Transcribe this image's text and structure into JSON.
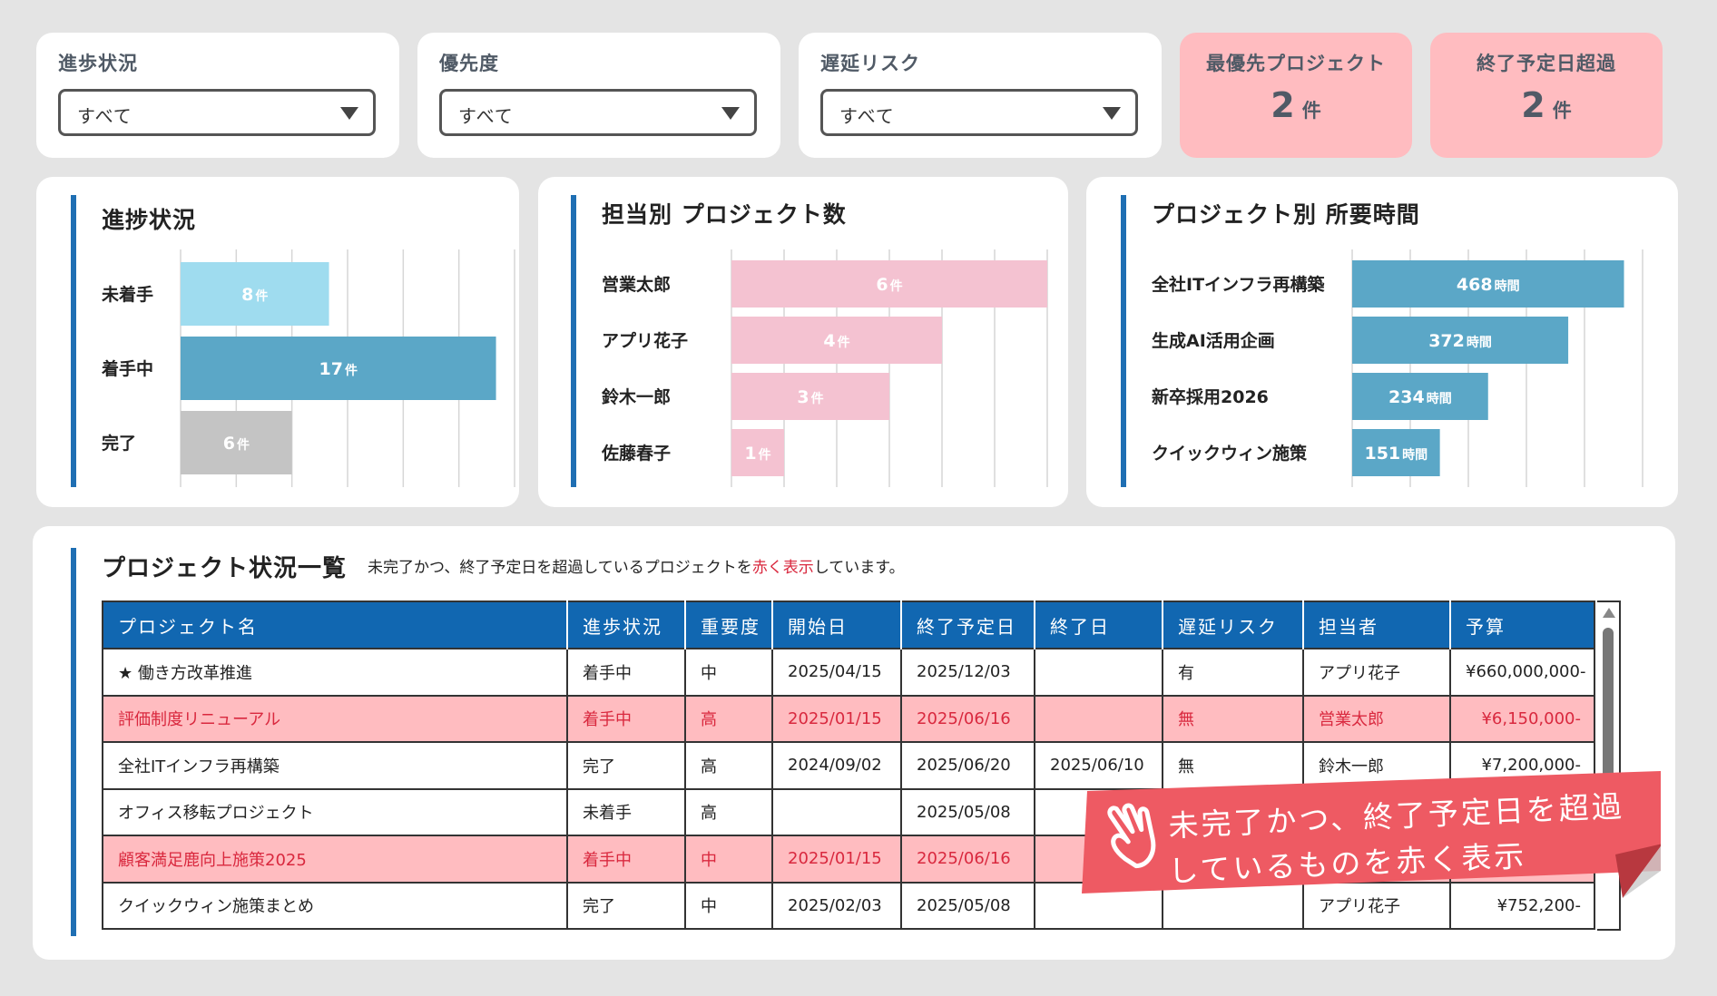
{
  "filters": [
    {
      "label": "進歩状況",
      "value": "すべて"
    },
    {
      "label": "優先度",
      "value": "すべて"
    },
    {
      "label": "遅延リスク",
      "value": "すべて"
    }
  ],
  "kpis": [
    {
      "label": "最優先プロジェクト",
      "value": "2",
      "unit": "件"
    },
    {
      "label": "終了予定日超過",
      "value": "2",
      "unit": "件"
    }
  ],
  "colors": {
    "accent": "#1f6fb3",
    "header_blue": "#1167b1",
    "overdue_bg": "#ffbcc0",
    "overdue_text": "#d9283e",
    "callout": "#ee5a63"
  },
  "charts": {
    "status": {
      "title": "進捗状況",
      "chart_data": {
        "type": "bar",
        "orientation": "horizontal",
        "categories": [
          "未着手",
          "着手中",
          "完了"
        ],
        "values": [
          8,
          17,
          6
        ],
        "unit": "件",
        "colors": [
          "#9fdcef",
          "#5ba7c7",
          "#c4c4c4"
        ],
        "xlim": [
          0,
          18
        ],
        "grid": true
      }
    },
    "owner": {
      "title": "担当別 プロジェクト数",
      "chart_data": {
        "type": "bar",
        "orientation": "horizontal",
        "categories": [
          "営業太郎",
          "アプリ花子",
          "鈴木一郎",
          "佐藤春子"
        ],
        "values": [
          6,
          4,
          3,
          1
        ],
        "unit": "件",
        "colors": [
          "#f4c2d1",
          "#f4c2d1",
          "#f4c2d1",
          "#f4c2d1"
        ],
        "xlim": [
          0,
          6
        ],
        "grid": true
      }
    },
    "hours": {
      "title": "プロジェクト別 所要時間",
      "chart_data": {
        "type": "bar",
        "orientation": "horizontal",
        "categories": [
          "全社ITインフラ再構築",
          "生成AI活用企画",
          "新卒採用2026",
          "クイックウィン施策"
        ],
        "values": [
          468,
          372,
          234,
          151
        ],
        "unit": "時間",
        "colors": [
          "#5ba7c7",
          "#5ba7c7",
          "#5ba7c7",
          "#5ba7c7"
        ],
        "xlim": [
          0,
          500
        ],
        "grid": true
      }
    }
  },
  "table": {
    "title": "プロジェクト状況一覧",
    "note_before": "未完了かつ、終了予定日を超過しているプロジェクトを",
    "note_red": "赤く表示",
    "note_after": "しています。",
    "columns": [
      "プロジェクト名",
      "進歩状況",
      "重要度",
      "開始日",
      "終了予定日",
      "終了日",
      "遅延リスク",
      "担当者",
      "予算"
    ],
    "rows": [
      {
        "overdue": false,
        "cells": [
          "★ 働き方改革推進",
          "着手中",
          "中",
          "2025/04/15",
          "2025/12/03",
          "",
          "有",
          "アプリ花子",
          "¥660,000,000-"
        ]
      },
      {
        "overdue": true,
        "cells": [
          "評価制度リニューアル",
          "着手中",
          "高",
          "2025/01/15",
          "2025/06/16",
          "",
          "無",
          "営業太郎",
          "¥6,150,000-"
        ]
      },
      {
        "overdue": false,
        "cells": [
          "全社ITインフラ再構築",
          "完了",
          "高",
          "2024/09/02",
          "2025/06/20",
          "2025/06/10",
          "無",
          "鈴木一郎",
          "¥7,200,000-"
        ]
      },
      {
        "overdue": false,
        "cells": [
          "オフィス移転プロジェクト",
          "未着手",
          "高",
          "",
          "2025/05/08",
          "",
          "",
          "",
          ""
        ]
      },
      {
        "overdue": true,
        "cells": [
          "顧客満足鹿向上施策2025",
          "着手中",
          "中",
          "2025/01/15",
          "2025/06/16",
          "",
          "",
          "",
          ""
        ]
      },
      {
        "overdue": false,
        "cells": [
          "クイックウィン施策まとめ",
          "完了",
          "中",
          "2025/02/03",
          "2025/05/08",
          "",
          "",
          "アプリ花子",
          "¥752,200-"
        ]
      }
    ]
  },
  "callout": {
    "line1": "未完了かつ、終了予定日を超過",
    "line2": "しているものを赤く表示",
    "icon": "hand-pointing-icon"
  }
}
